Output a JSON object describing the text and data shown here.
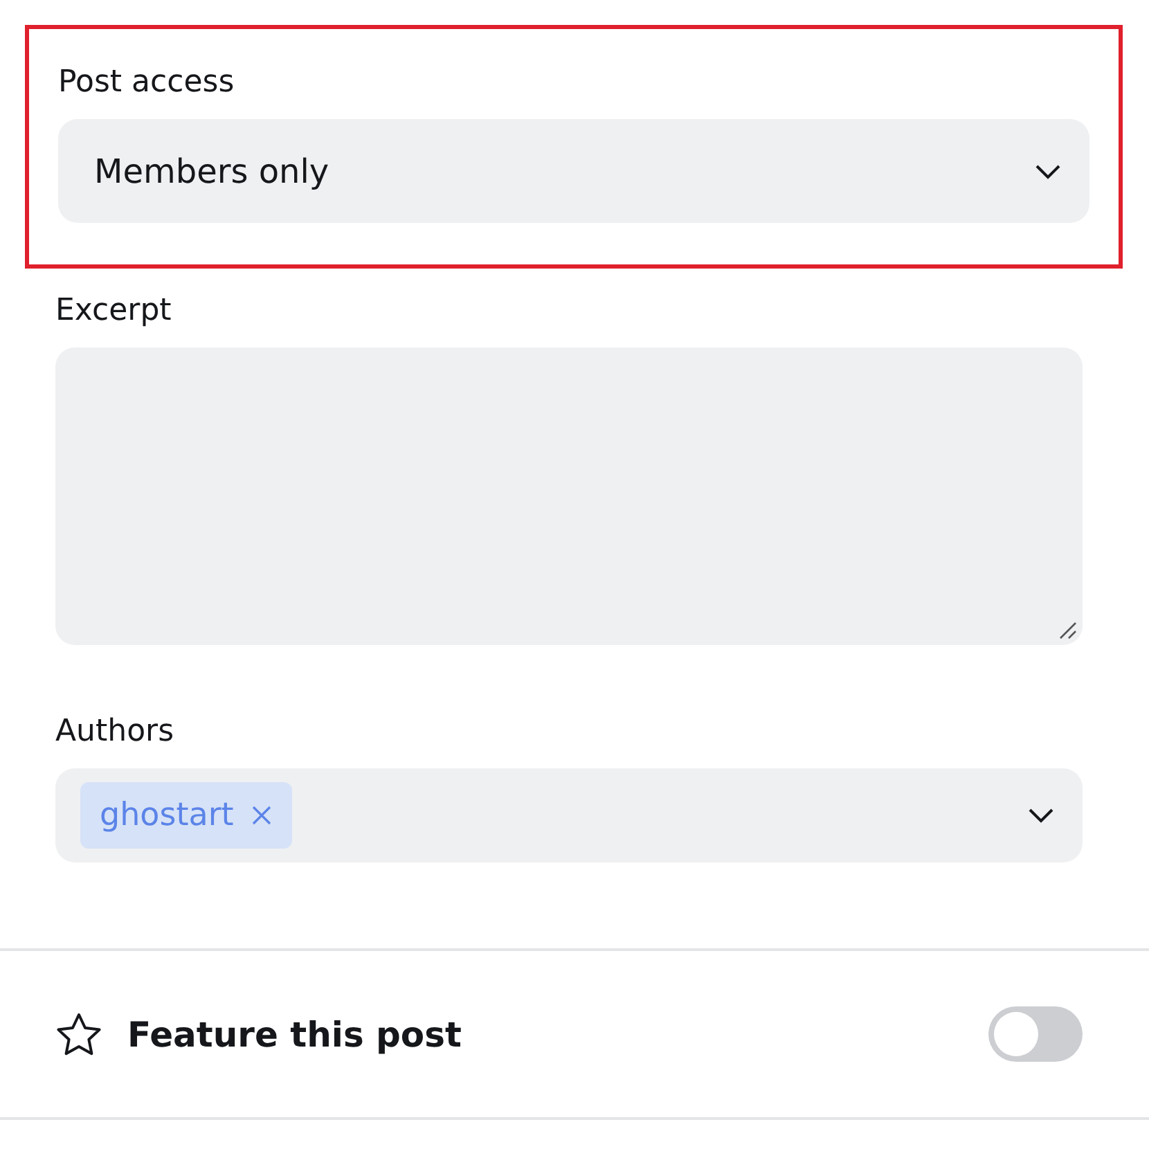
{
  "post_access": {
    "label": "Post access",
    "value": "Members only",
    "highlighted": true
  },
  "excerpt": {
    "label": "Excerpt"
  },
  "authors": {
    "label": "Authors",
    "tags": [
      "ghostart"
    ]
  },
  "feature": {
    "label": "Feature this post",
    "on": false
  }
}
